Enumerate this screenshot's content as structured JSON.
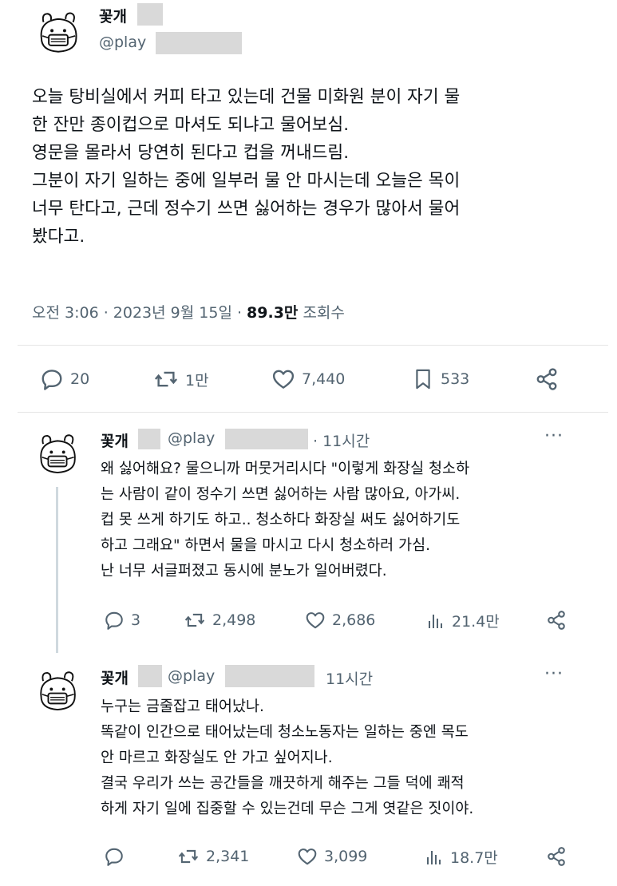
{
  "main_tweet": {
    "name": "꽃개",
    "handle": "@play",
    "text": "오늘 탕비실에서 커피 타고 있는데 건물 미화원 분이 자기 물\n한 잔만 종이컵으로 마셔도 되냐고 물어보심.\n영문을 몰라서 당연히 된다고 컵을 꺼내드림.\n그분이 자기 일하는 중에 일부러 물 안 마시는데 오늘은 목이\n너무 탄다고, 근데 정수기 쓰면 싫어하는 경우가 많아서 물어\n봤다고.",
    "timestamp": "오전 3:06 · 2023년 9월 15일 · ",
    "views_count": "89.3만",
    "views_label": " 조회수",
    "replies": "20",
    "retweets": "1만",
    "likes": "7,440",
    "bookmarks": "533"
  },
  "replies": [
    {
      "name": "꽃개",
      "handle": "@play",
      "time": "· 11시간",
      "text": "왜 싫어해요? 물으니까 머뭇거리시다 \"이렇게 화장실 청소하\n는 사람이 같이 정수기 쓰면 싫어하는 사람 많아요, 아가씨.\n컵 못 쓰게 하기도 하고.. 청소하다 화장실 써도 싫어하기도\n하고 그래요\" 하면서 물을 마시고 다시 청소하러 가심.\n난 너무 서글퍼졌고 동시에 분노가 일어버렸다.",
      "replies": "3",
      "retweets": "2,498",
      "likes": "2,686",
      "views": "21.4만"
    },
    {
      "name": "꽃개",
      "handle": "@play",
      "time": "11시간",
      "text": "누구는 금줄잡고 태어났나.\n똑같이 인간으로 태어났는데 청소노동자는 일하는 중엔 목도\n안 마르고 화장실도 안 가고 싶어지나.\n결국 우리가 쓰는 공간들을 깨끗하게 해주는 그들 덕에 쾌적\n하게 자기 일에 집중할 수 있는건데 무슨 그게 엿같은 짓이야.",
      "replies": "",
      "retweets": "2,341",
      "likes": "3,099",
      "views": "18.7만"
    }
  ],
  "icons": {
    "more": "more-dots-icon",
    "reply": "reply-icon",
    "retweet": "retweet-icon",
    "like": "heart-icon",
    "bookmark": "bookmark-icon",
    "views": "views-chart-icon",
    "share": "share-icon"
  }
}
